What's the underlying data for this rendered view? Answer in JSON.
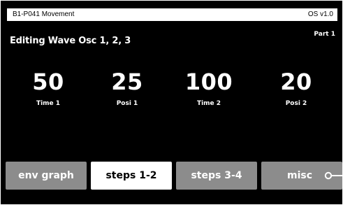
{
  "titlebar": {
    "patch_name": "B1-P041 Movement",
    "os_version": "OS v1.0"
  },
  "heading": "Editing Wave Osc 1, 2, 3",
  "part_label": "Part 1",
  "params": [
    {
      "value": "50",
      "label": "Time 1"
    },
    {
      "value": "25",
      "label": "Posi 1"
    },
    {
      "value": "100",
      "label": "Time 2"
    },
    {
      "value": "20",
      "label": "Posi 2"
    }
  ],
  "tabs": [
    {
      "label": "env graph",
      "active": false
    },
    {
      "label": "steps 1-2",
      "active": true
    },
    {
      "label": "steps 3-4",
      "active": false
    },
    {
      "label": "misc",
      "active": false
    }
  ],
  "icons": {
    "misc_indicator": "knob-toggle-icon"
  },
  "colors": {
    "background": "#000000",
    "tab_inactive": "#8c8c8c",
    "tab_active": "#ffffff"
  }
}
